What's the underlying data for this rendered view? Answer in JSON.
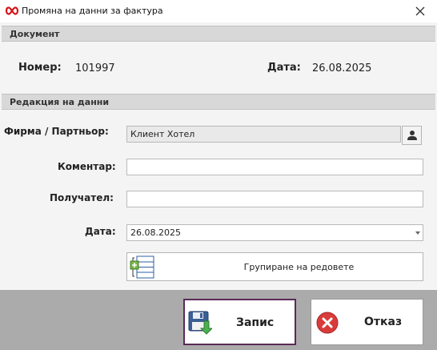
{
  "window": {
    "title": "Промяна на данни за фактура",
    "icons": {
      "app": "infinity-logo-icon",
      "close": "close-icon"
    }
  },
  "document_section": {
    "header": "Документ",
    "number_label": "Номер:",
    "number_value": "101997",
    "date_label": "Дата:",
    "date_value": "26.08.2025"
  },
  "edit_section": {
    "header": "Редакция на данни",
    "partner_label": "Фирма / Партньор:",
    "partner_value": "Клиент Хотел",
    "comment_label": "Коментар:",
    "comment_value": "",
    "recipient_label": "Получател:",
    "recipient_value": "",
    "date_label": "Дата:",
    "date_value": "26.08.2025",
    "group_rows_label": "Групиране на редовете"
  },
  "footer": {
    "save_label": "Запис",
    "cancel_label": "Отказ"
  },
  "colors": {
    "logo_red": "#d7141a",
    "save_border": "#5a2a59",
    "cancel_red": "#d93b3b",
    "footer_bg": "#ababab"
  }
}
